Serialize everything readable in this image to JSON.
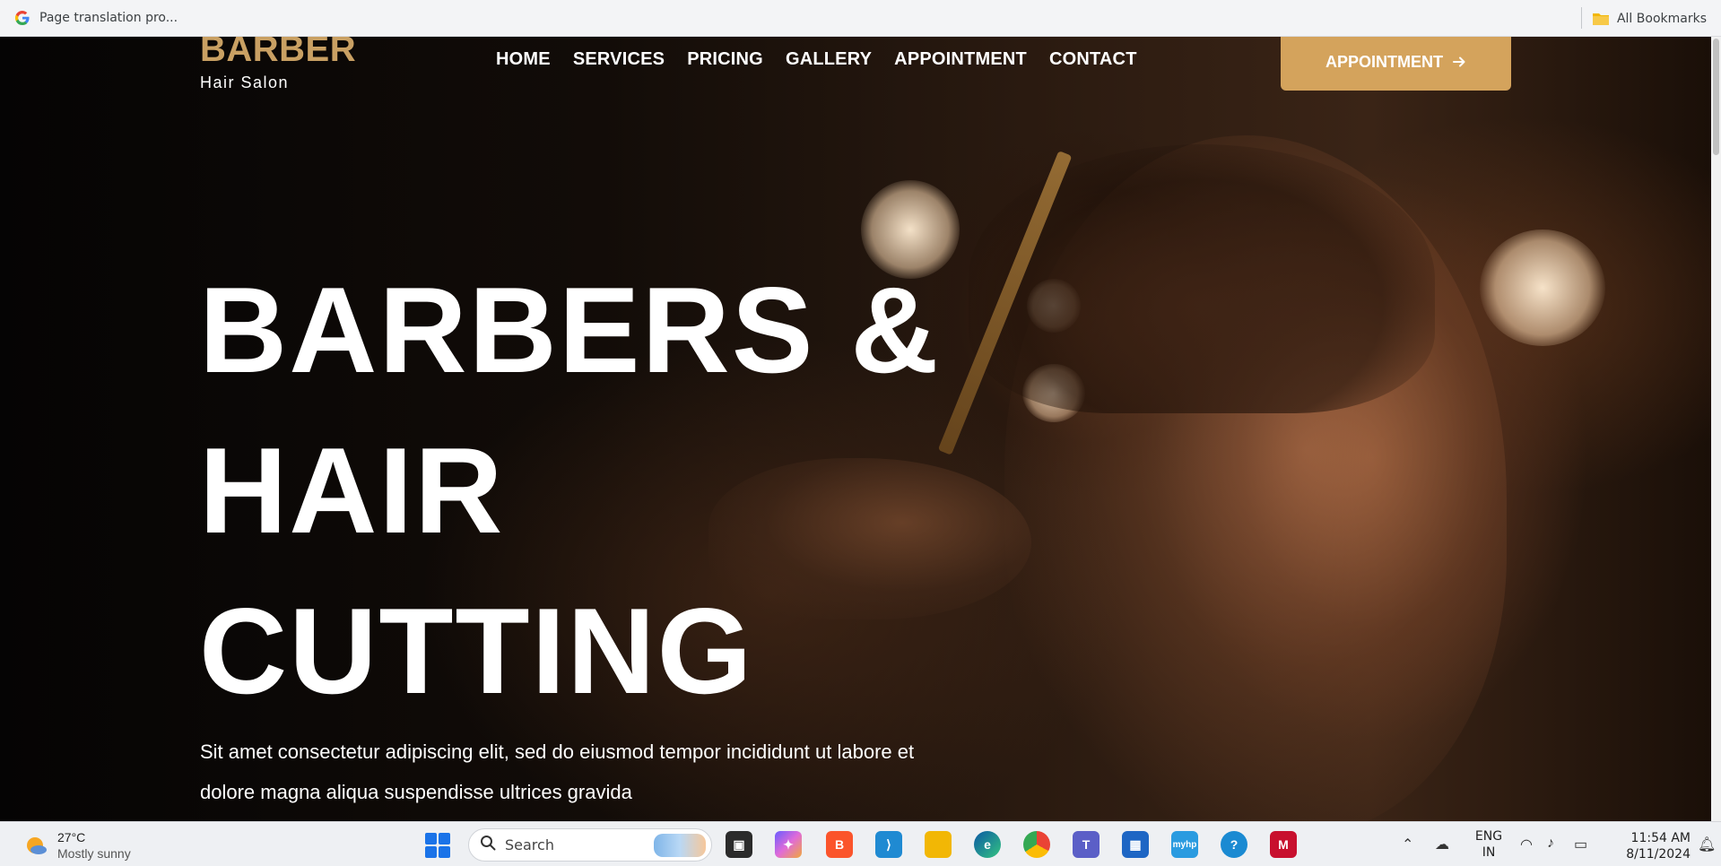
{
  "browser": {
    "tab_title": "Page translation pro...",
    "bookmarks_label": "All Bookmarks",
    "icons": [
      "google-icon",
      "folder-icon"
    ]
  },
  "site": {
    "logo_title": "BARBER",
    "logo_subtitle": "Hair Salon",
    "nav": [
      "HOME",
      "SERVICES",
      "PRICING",
      "GALLERY",
      "APPOINTMENT",
      "CONTACT"
    ],
    "cta_label": "APPOINTMENT",
    "cta_icon": "arrow-right-icon",
    "colors": {
      "accent": "#d4a35c",
      "logo": "#c9a063",
      "text": "#ffffff"
    }
  },
  "hero": {
    "title_lines": [
      "BARBERS &",
      "HAIR",
      "CUTTING"
    ],
    "description": "Sit amet consectetur adipiscing elit, sed do eiusmod tempor incididunt ut labore et dolore magna aliqua suspendisse ultrices gravida"
  },
  "taskbar": {
    "temperature": "27°C",
    "condition": "Mostly sunny",
    "search_placeholder": "Search",
    "language": "ENG",
    "region": "IN",
    "time": "11:54 AM",
    "date": "8/11/2024",
    "app_icons": [
      "file-explorer-task-icon",
      "copilot-icon",
      "brave-icon",
      "vscode-icon",
      "folder-icon",
      "edge-icon",
      "chrome-icon",
      "teams-icon",
      "store-icon",
      "myhp-icon",
      "help-icon",
      "mcafee-icon"
    ]
  }
}
